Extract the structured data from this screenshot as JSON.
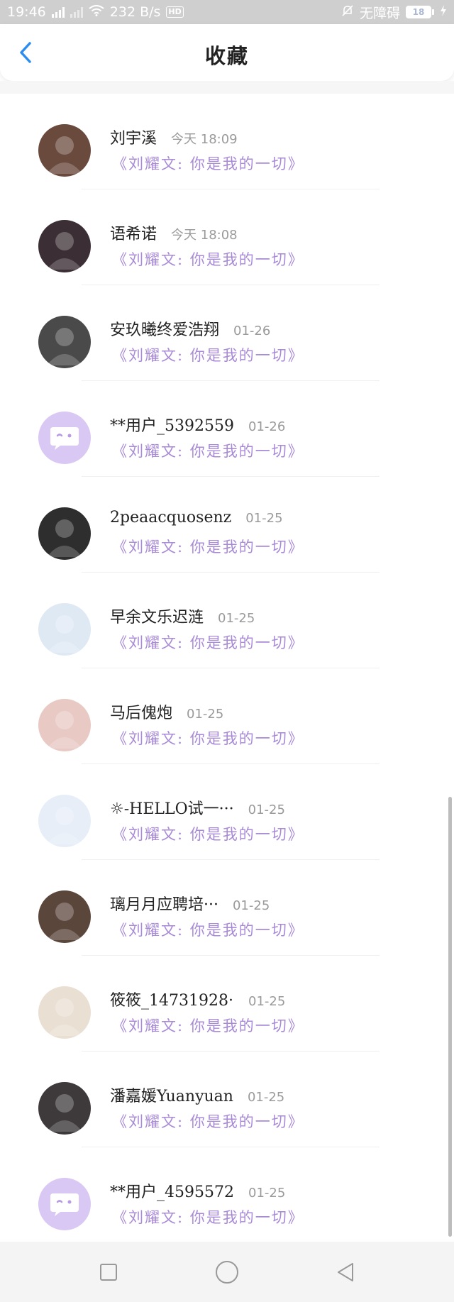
{
  "status_bar": {
    "time": "19:46",
    "speed": "232 B/s",
    "hd": "HD",
    "carrier": "无障碍",
    "battery": "18"
  },
  "header": {
    "title": "收藏"
  },
  "favorites": [
    {
      "name": "刘宇溪",
      "time": "今天 18:09",
      "quote": "《刘耀文: 你是我的一切》",
      "avatar_bg": "#6b4a3e",
      "avatar_icon": "photo-avatar"
    },
    {
      "name": "语希诺",
      "time": "今天 18:08",
      "quote": "《刘耀文: 你是我的一切》",
      "avatar_bg": "#3b2f35",
      "avatar_icon": "photo-avatar"
    },
    {
      "name": "安玖曦终爱浩翔",
      "time": "01-26",
      "quote": "《刘耀文: 你是我的一切》",
      "avatar_bg": "#4a4a4a",
      "avatar_icon": "photo-avatar"
    },
    {
      "name": "**用户_5392559···",
      "time": "01-26",
      "quote": "《刘耀文: 你是我的一切》",
      "avatar_bg": "#d9c8f3",
      "avatar_icon": "chat-bubble-icon"
    },
    {
      "name": "2peaacquosenz",
      "time": "01-25",
      "quote": "《刘耀文: 你是我的一切》",
      "avatar_bg": "#2e2e2e",
      "avatar_icon": "photo-avatar"
    },
    {
      "name": "早余文乐迟涟",
      "time": "01-25",
      "quote": "《刘耀文: 你是我的一切》",
      "avatar_bg": "#dfe9f4",
      "avatar_icon": "photo-avatar"
    },
    {
      "name": "马后傀炮",
      "time": "01-25",
      "quote": "《刘耀文: 你是我的一切》",
      "avatar_bg": "#e8c9c4",
      "avatar_icon": "photo-avatar"
    },
    {
      "name": "☼-HELLO试一···",
      "time": "01-25",
      "quote": "《刘耀文: 你是我的一切》",
      "avatar_bg": "#e7eef8",
      "avatar_icon": "photo-avatar"
    },
    {
      "name": "璃月月应聘培···",
      "time": "01-25",
      "quote": "《刘耀文: 你是我的一切》",
      "avatar_bg": "#5b463c",
      "avatar_icon": "photo-avatar"
    },
    {
      "name": "筱筱_14731928···",
      "time": "01-25",
      "quote": "《刘耀文: 你是我的一切》",
      "avatar_bg": "#eadfd3",
      "avatar_icon": "photo-avatar"
    },
    {
      "name": "潘嘉媛Yuanyuan",
      "time": "01-25",
      "quote": "《刘耀文: 你是我的一切》",
      "avatar_bg": "#3e3a3c",
      "avatar_icon": "photo-avatar"
    },
    {
      "name": "**用户_4595572···",
      "time": "01-25",
      "quote": "《刘耀文: 你是我的一切》",
      "avatar_bg": "#d9c8f3",
      "avatar_icon": "chat-bubble-icon"
    }
  ],
  "colors": {
    "accent_blue": "#2d8cf0",
    "quote_purple": "#a88ad6",
    "status_bar_bg": "#cfcfcf"
  }
}
